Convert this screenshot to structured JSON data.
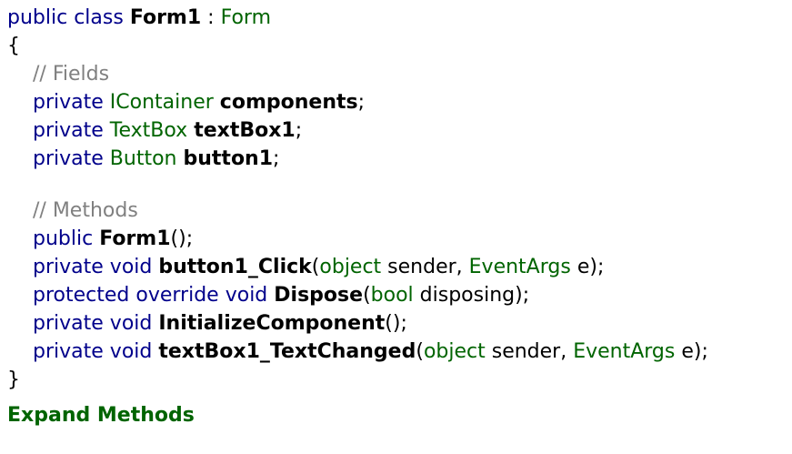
{
  "colors": {
    "keyword": "#00008b",
    "type": "#006400",
    "comment": "#808080",
    "identifier": "#000000",
    "link": "#006400"
  },
  "code": {
    "header": {
      "kw1": "public",
      "kw2": "class",
      "name": "Form1",
      "sep": " : ",
      "base": "Form"
    },
    "open_brace": "{",
    "fields_comment": "// Fields",
    "fields": [
      {
        "mod": "private",
        "type": "IContainer",
        "name": "components",
        "end": ";"
      },
      {
        "mod": "private",
        "type": "TextBox",
        "name": "textBox1",
        "end": ";"
      },
      {
        "mod": "private",
        "type": "Button",
        "name": "button1",
        "end": ";"
      }
    ],
    "methods_comment": "// Methods",
    "ctor": {
      "mod": "public",
      "name": "Form1",
      "end": "();"
    },
    "m1": {
      "mod": "private",
      "ret": "void",
      "name": "button1_Click",
      "open": "(",
      "p1type": "object",
      "p1name": " sender, ",
      "p2type": "EventArgs",
      "p2name": " e",
      "end": ");"
    },
    "m2": {
      "mod": "protected",
      "mod2": "override",
      "ret": "void",
      "name": "Dispose",
      "open": "(",
      "p1type": "bool",
      "p1name": " disposing",
      "end": ");"
    },
    "m3": {
      "mod": "private",
      "ret": "void",
      "name": "InitializeComponent",
      "end": "();"
    },
    "m4": {
      "mod": "private",
      "ret": "void",
      "name": "textBox1_TextChanged",
      "open": "(",
      "p1type": "object",
      "p1name": " sender, ",
      "p2type": "EventArgs",
      "p2name": " e",
      "end": ");"
    },
    "close_brace": "}"
  },
  "expand_link": "Expand Methods"
}
